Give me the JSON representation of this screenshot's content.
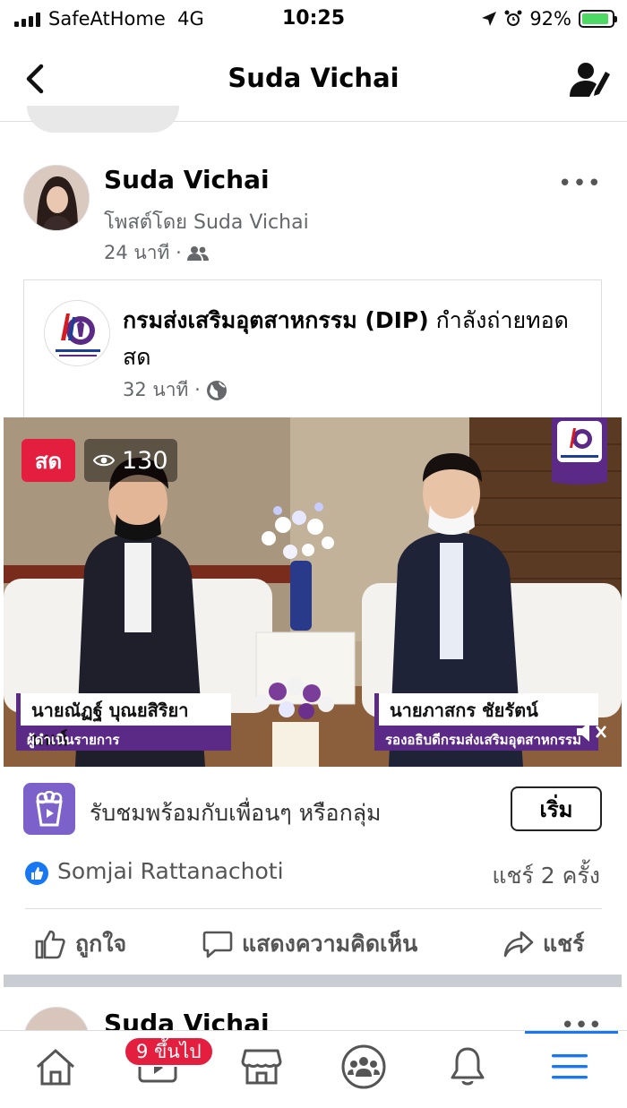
{
  "status_bar": {
    "carrier": "SafeAtHome",
    "network": "4G",
    "time": "10:25",
    "battery": "92%",
    "battery_level": 0.92,
    "battery_color": "#4cd964"
  },
  "nav": {
    "title": "Suda Vichai",
    "back_icon": "chevron-left-icon",
    "right_icon": "profile-edit-icon"
  },
  "post": {
    "author": "Suda Vichai",
    "posted_by": "โพสต์โดย Suda Vichai",
    "time": "24 นาที ·",
    "audience_icon": "friends-icon",
    "more_label": "•••"
  },
  "shared": {
    "page_name": "กรมส่งเสริมอุตสาหกรรม (DIP)",
    "action": "กำลังถ่ายทอดสด",
    "time": "32 นาที ·",
    "audience_icon": "globe-icon"
  },
  "video": {
    "live_label": "สด",
    "viewer_count": "130",
    "left_name": "นายณัฏฐ์ บุณยสิริยานนท์",
    "left_role": "ผู้ดำเนินรายการ",
    "right_name": "นายภาสกร ชัยรัตน์",
    "right_role": "รองอธิบดีกรมส่งเสริมอุตสาหกรรม",
    "live_color": "#e41e3f",
    "lower_third_color": "#5b2a86"
  },
  "watch_party": {
    "text": "รับชมพร้อมกับเพื่อนๆ หรือกลุ่ม",
    "button": "เริ่ม"
  },
  "reactions": {
    "reactor": "Somjai Rattanachoti",
    "shares": "แชร์ 2 ครั้ง"
  },
  "actions": {
    "like": "ถูกใจ",
    "comment": "แสดงความคิดเห็น",
    "share": "แชร์"
  },
  "next_post": {
    "author": "Suda Vichai",
    "more_label": "•••"
  },
  "tabbar": {
    "tabs": [
      "home-icon",
      "video-icon",
      "marketplace-icon",
      "groups-icon",
      "bell-icon",
      "menu-icon"
    ],
    "video_badge": "9 ขึ้นไป",
    "active_tab": "menu-icon",
    "accent": "#1877f2"
  }
}
